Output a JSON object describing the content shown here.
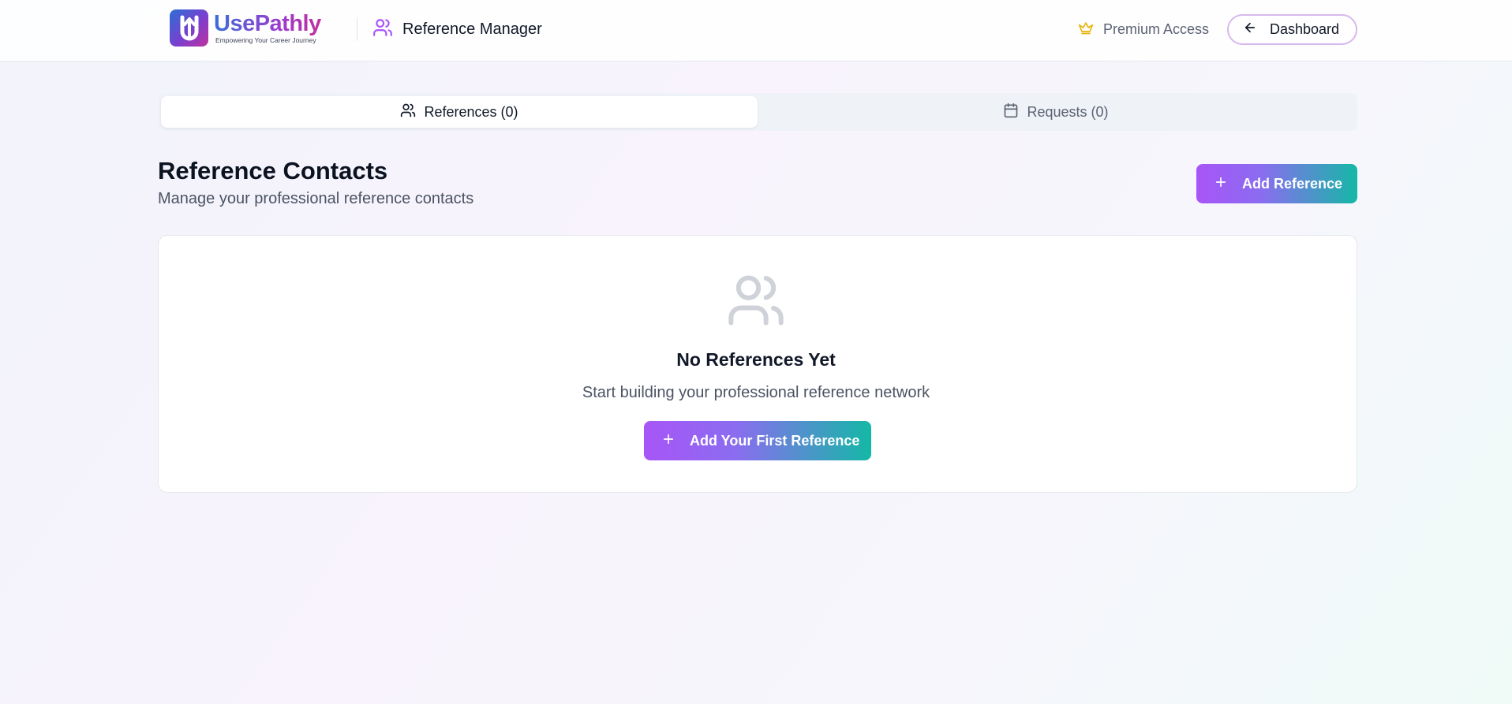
{
  "header": {
    "logo": {
      "name": "UsePathly",
      "tagline": "Empowering Your Career Journey",
      "icon": "upload-arrow-icon"
    },
    "page_title": "Reference Manager",
    "page_icon": "users-icon",
    "premium": {
      "label": "Premium Access",
      "icon": "crown-icon"
    },
    "dashboard_button": {
      "label": "Dashboard",
      "icon": "arrow-left-icon"
    }
  },
  "tabs": [
    {
      "label": "References (0)",
      "icon": "users-icon",
      "active": true
    },
    {
      "label": "Requests (0)",
      "icon": "calendar-icon",
      "active": false
    }
  ],
  "section": {
    "title": "Reference Contacts",
    "subtitle": "Manage your professional reference contacts",
    "add_button": {
      "label": "Add Reference",
      "icon": "plus-icon"
    }
  },
  "empty_state": {
    "icon": "users-icon",
    "title": "No References Yet",
    "subtitle": "Start building your professional reference network",
    "button": {
      "label": "Add Your First Reference",
      "icon": "plus-icon"
    }
  },
  "colors": {
    "brand_purple": "#a855f7",
    "brand_teal": "#14b8a6",
    "premium_gold": "#eab308",
    "accent_icon": "#a855f7"
  }
}
